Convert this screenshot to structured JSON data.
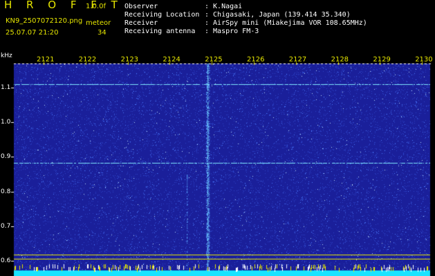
{
  "header": {
    "brand": "H R O F F T",
    "version": "1.0.0f",
    "filename": "KN9_2507072120.png",
    "timestamp": "25.07.07 21:20",
    "mode_label": "meteor",
    "count": "34",
    "info_rows": [
      {
        "label": "Observer",
        "value": ": K.Nagai"
      },
      {
        "label": "Receiving Location",
        "value": ": Chigasaki, Japan (139.414 35.340)"
      },
      {
        "label": "Receiver",
        "value": ": AirSpy mini (Miakejima VOR 108.65MHz)"
      },
      {
        "label": "Receiving antenna",
        "value": ": Maspro FM-3"
      }
    ]
  },
  "chart_data": {
    "type": "heatmap",
    "ylabel": "kHz",
    "x_ticks": [
      "2121",
      "2122",
      "2123",
      "2124",
      "2125",
      "2126",
      "2127",
      "2128",
      "2129",
      "2130"
    ],
    "y_ticks": [
      "1.1",
      "1.0",
      "0.9",
      "0.8",
      "0.7",
      "0.6"
    ],
    "ylim": [
      0.575,
      1.17
    ],
    "horizontal_lines_khz": [
      1.11,
      0.882
    ],
    "reference_lines_khz": [
      0.618,
      0.605
    ],
    "vertical_trace_tick": 2125,
    "colors": {
      "background": "#1a1f9a",
      "noise": "#4a7bff",
      "trace": "#7fe8ff",
      "reference": "#e6e600",
      "bottom_band": "#18e3ff"
    }
  }
}
